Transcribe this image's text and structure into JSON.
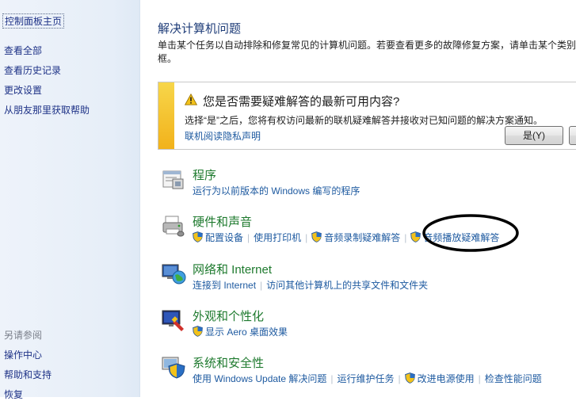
{
  "sidebar": {
    "home": "控制面板主页",
    "items": [
      "查看全部",
      "查看历史记录",
      "更改设置",
      "从朋友那里获取帮助"
    ],
    "see_also_heading": "另请参阅",
    "see_also": [
      "操作中心",
      "帮助和支持",
      "恢复"
    ]
  },
  "main": {
    "title": "解决计算机问题",
    "description": "单击某个任务以自动排除和修复常见的计算机问题。若要查看更多的故障修复方案，请单击某个类别框。"
  },
  "notice": {
    "title": "您是否需要疑难解答的最新可用内容?",
    "text": "选择“是”之后，您将有权访问最新的联机疑难解答并接收对已知问题的解决方案通知。",
    "link": "联机阅读隐私声明",
    "yes_button": "是(Y)"
  },
  "categories": [
    {
      "title": "程序",
      "icon": "programs-icon",
      "links": [
        "运行为以前版本的 Windows 编写的程序"
      ]
    },
    {
      "title": "硬件和声音",
      "icon": "hardware-printer-icon",
      "links": [
        "配置设备",
        "使用打印机",
        "音频录制疑难解答",
        "音频播放疑难解答"
      ]
    },
    {
      "title": "网络和 Internet",
      "icon": "network-globe-icon",
      "links": [
        "连接到 Internet",
        "访问其他计算机上的共享文件和文件夹"
      ]
    },
    {
      "title": "外观和个性化",
      "icon": "appearance-icon",
      "links": [
        "显示 Aero 桌面效果"
      ]
    },
    {
      "title": "系统和安全性",
      "icon": "system-security-icon",
      "links": [
        "使用 Windows Update 解决问题",
        "运行维护任务",
        "改进电源使用",
        "检查性能问题"
      ]
    }
  ],
  "colors": {
    "link": "#1e5aa0",
    "category_title": "#1e7a2e",
    "sidebar_link": "#1e3287",
    "notice_bar": "#f2b21b"
  }
}
